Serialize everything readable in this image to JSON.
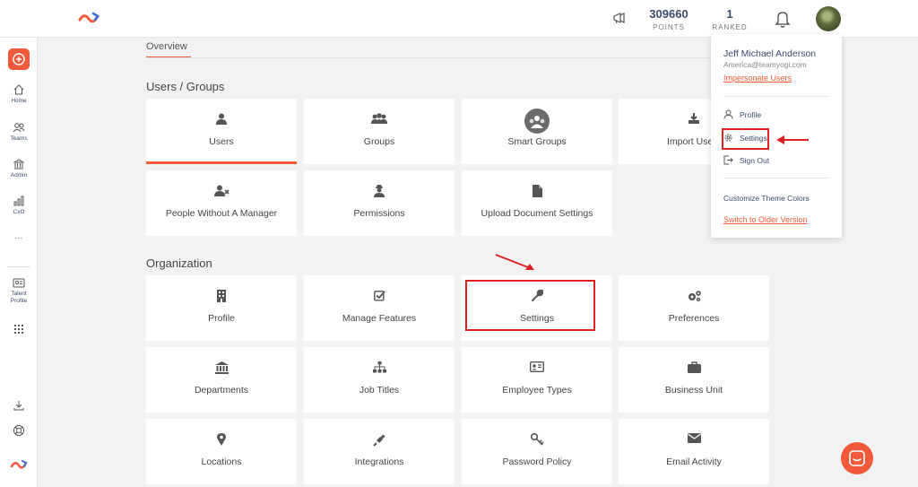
{
  "header": {
    "points_value": "309660",
    "points_label": "POINTS",
    "ranked_value": "1",
    "ranked_label": "RANKED"
  },
  "rail": {
    "home": "Home",
    "teams": "Teams",
    "admin": "Admin",
    "cxo": "CxO",
    "more": "···",
    "talent_profile_1": "Talent",
    "talent_profile_2": "Profile"
  },
  "tabs": {
    "overview": "Overview"
  },
  "sections": {
    "users_groups": "Users / Groups",
    "organization": "Organization"
  },
  "cards": {
    "users": "Users",
    "groups": "Groups",
    "smart_groups": "Smart Groups",
    "import_users": "Import Users",
    "people_without_manager": "People Without A Manager",
    "permissions": "Permissions",
    "upload_document_settings": "Upload Document Settings",
    "profile": "Profile",
    "manage_features": "Manage Features",
    "settings": "Settings",
    "preferences": "Preferences",
    "departments": "Departments",
    "job_titles": "Job Titles",
    "employee_types": "Employee Types",
    "business_unit": "Business Unit",
    "locations": "Locations",
    "integrations": "Integrations",
    "password_policy": "Password Policy",
    "email_activity": "Email Activity"
  },
  "dropdown": {
    "name": "Jeff Michael Anderson",
    "email": "America@teamyogi.com",
    "impersonate": "Impersonate Users",
    "profile": "Profile",
    "settings": "Settings",
    "sign_out": "Sign Out",
    "theme": "Customize Theme Colors",
    "older_version": "Switch to Older Version"
  },
  "colors": {
    "accent": "#f05a3a",
    "annotation": "#e02020",
    "navy": "#3b4a6b"
  },
  "icons": [
    "logo-icon",
    "megaphone-icon",
    "bell-icon",
    "plus-icon",
    "home-icon",
    "teams-icon",
    "admin-icon",
    "cxo-icon",
    "talent-profile-icon",
    "apps-grid-icon",
    "download-icon",
    "support-icon",
    "chat-icon"
  ]
}
